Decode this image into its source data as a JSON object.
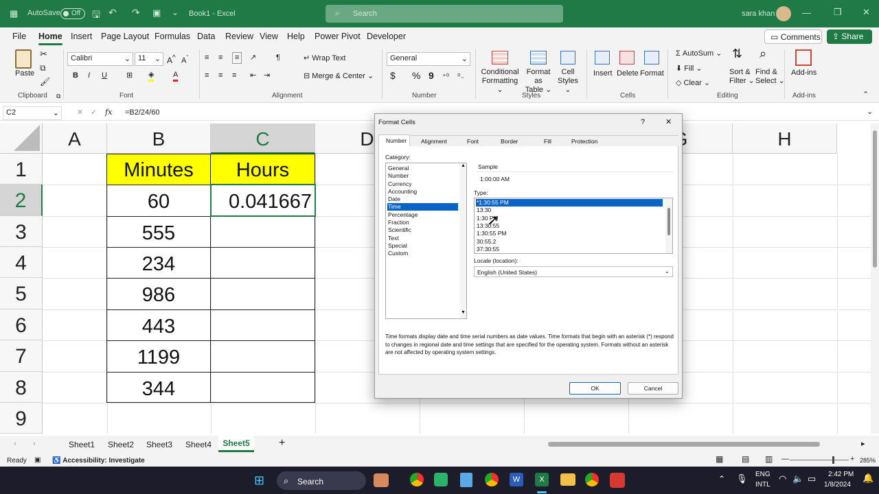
{
  "titlebar": {
    "autosave": "AutoSave",
    "toggle": "Off",
    "book": "Book1 - Excel",
    "search": "Search",
    "user": "sara khan"
  },
  "tabs": [
    "File",
    "Home",
    "Insert",
    "Page Layout",
    "Formulas",
    "Data",
    "Review",
    "View",
    "Help",
    "Power Pivot",
    "Developer"
  ],
  "tab_buttons": {
    "comments": "Comments",
    "share": "Share"
  },
  "ribbon": {
    "paste": "Paste",
    "clipboard": "Clipboard",
    "font_name": "Calibri",
    "font_size": "11",
    "font_group": "Font",
    "bold": "B",
    "italic": "I",
    "underline": "U",
    "wrap_text": "Wrap Text",
    "merge_center": "Merge & Center",
    "alignment": "Alignment",
    "number_format": "General",
    "number": "Number",
    "dollar": "$",
    "percent": "%",
    "comma": "9",
    "cond_format_1": "Conditional",
    "cond_format_2": "Formatting",
    "format_table_1": "Format as",
    "format_table_2": "Table",
    "cell_styles_1": "Cell",
    "cell_styles_2": "Styles",
    "styles": "Styles",
    "insert": "Insert",
    "delete": "Delete",
    "format": "Format",
    "cells": "Cells",
    "autosum": "AutoSum",
    "fill": "Fill",
    "clear": "Clear",
    "sort_1": "Sort &",
    "sort_2": "Filter",
    "find_1": "Find &",
    "find_2": "Select",
    "editing": "Editing",
    "addins": "Add-ins",
    "addins_group": "Add-ins"
  },
  "formula_bar": {
    "name_box": "C2",
    "fx": "fx",
    "formula": "=B2/24/60"
  },
  "columns": [
    "A",
    "B",
    "C",
    "D",
    "E",
    "F",
    "G",
    "H"
  ],
  "rows": [
    "1",
    "2",
    "3",
    "4",
    "5",
    "6",
    "7",
    "8",
    "9"
  ],
  "cells": {
    "B1": "Minutes",
    "C1": "Hours",
    "B2": "60",
    "C2": "0.041667",
    "B3": "555",
    "B4": "234",
    "B5": "986",
    "B6": "443",
    "B7": "1199",
    "B8": "344"
  },
  "colors": {
    "header_fill": "#ffff00",
    "excel_green": "#1f7a45",
    "selection": "#0a64c8"
  },
  "sheets": [
    "Sheet1",
    "Sheet2",
    "Sheet3",
    "Sheet4",
    "Sheet5"
  ],
  "active_sheet": "Sheet5",
  "status": {
    "ready": "Ready",
    "accessibility": "Accessibility: Investigate",
    "zoom": "285%"
  },
  "dialog": {
    "title": "Format Cells",
    "help": "?",
    "close": "✕",
    "tabs": [
      "Number",
      "Alignment",
      "Font",
      "Border",
      "Fill",
      "Protection"
    ],
    "category_label": "Category:",
    "categories": [
      "General",
      "Number",
      "Currency",
      "Accounting",
      "Date",
      "Time",
      "Percentage",
      "Fraction",
      "Scientific",
      "Text",
      "Special",
      "Custom"
    ],
    "selected_category": "Time",
    "sample_label": "Sample",
    "sample_value": "1:00:00 AM",
    "type_label": "Type:",
    "types": [
      "*1:30:55 PM",
      "13:30",
      "1:30 PM",
      "13:30:55",
      "1:30:55 PM",
      "30:55.2",
      "37:30:55"
    ],
    "locale_label": "Locale (location):",
    "locale_value": "English (United States)",
    "description": "Time formats display date and time serial numbers as date values.  Time formats that begin with an asterisk (*) respond to changes in regional date and time settings that are specified for the operating system. Formats without an asterisk are not affected by operating system settings.",
    "ok": "OK",
    "cancel": "Cancel"
  },
  "taskbar": {
    "search": "Search",
    "lang_1": "ENG",
    "lang_2": "INTL",
    "time": "2:42 PM",
    "date": "1/8/2024"
  }
}
